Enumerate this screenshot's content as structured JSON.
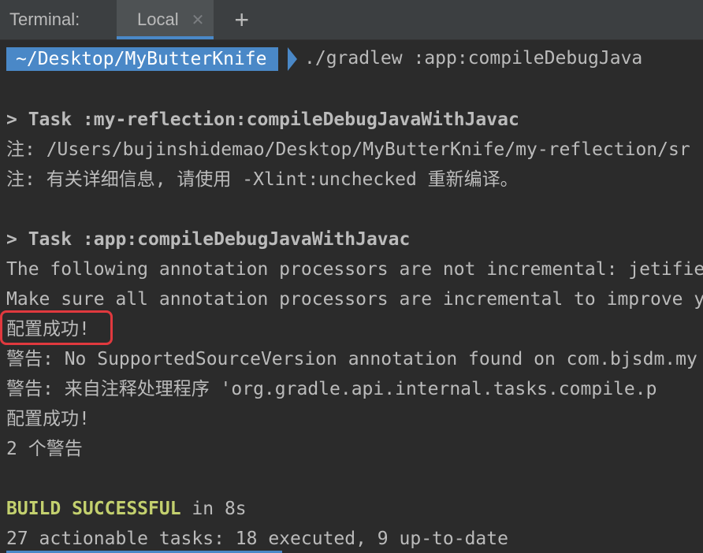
{
  "tabbar": {
    "title": "Terminal:",
    "tab_label": "Local",
    "close_glyph": "✕",
    "add_glyph": "+"
  },
  "prompt": {
    "path": "~/Desktop/MyButterKnife",
    "command": "./gradlew :app:compileDebugJava"
  },
  "output": {
    "task1": "> Task :my-reflection:compileDebugJavaWithJavac",
    "note1": "注: /Users/bujinshidemao/Desktop/MyButterKnife/my-reflection/sr",
    "note2": "注: 有关详细信息, 请使用 -Xlint:unchecked 重新编译。",
    "task2": "> Task :app:compileDebugJavaWithJavac",
    "processors1": "The following annotation processors are not incremental: jetifie",
    "processors2": "Make sure all annotation processors are incremental to improve y",
    "config_success_1": "配置成功!",
    "warning1": "警告: No SupportedSourceVersion annotation found on com.bjsdm.my",
    "warning2": "警告: 来自注释处理程序 'org.gradle.api.internal.tasks.compile.p",
    "config_success_2": "配置成功!",
    "warning_count": "2 个警告",
    "build_status": "BUILD SUCCESSFUL",
    "build_time": " in 8s",
    "tasks_summary": "27 actionable tasks: 18 executed, 9 up-to-date"
  },
  "colors": {
    "background": "#2b2b2b",
    "tabbar": "#3c3f41",
    "accent": "#4a88c7",
    "success": "#c3d06e",
    "highlight": "#e0393e"
  }
}
